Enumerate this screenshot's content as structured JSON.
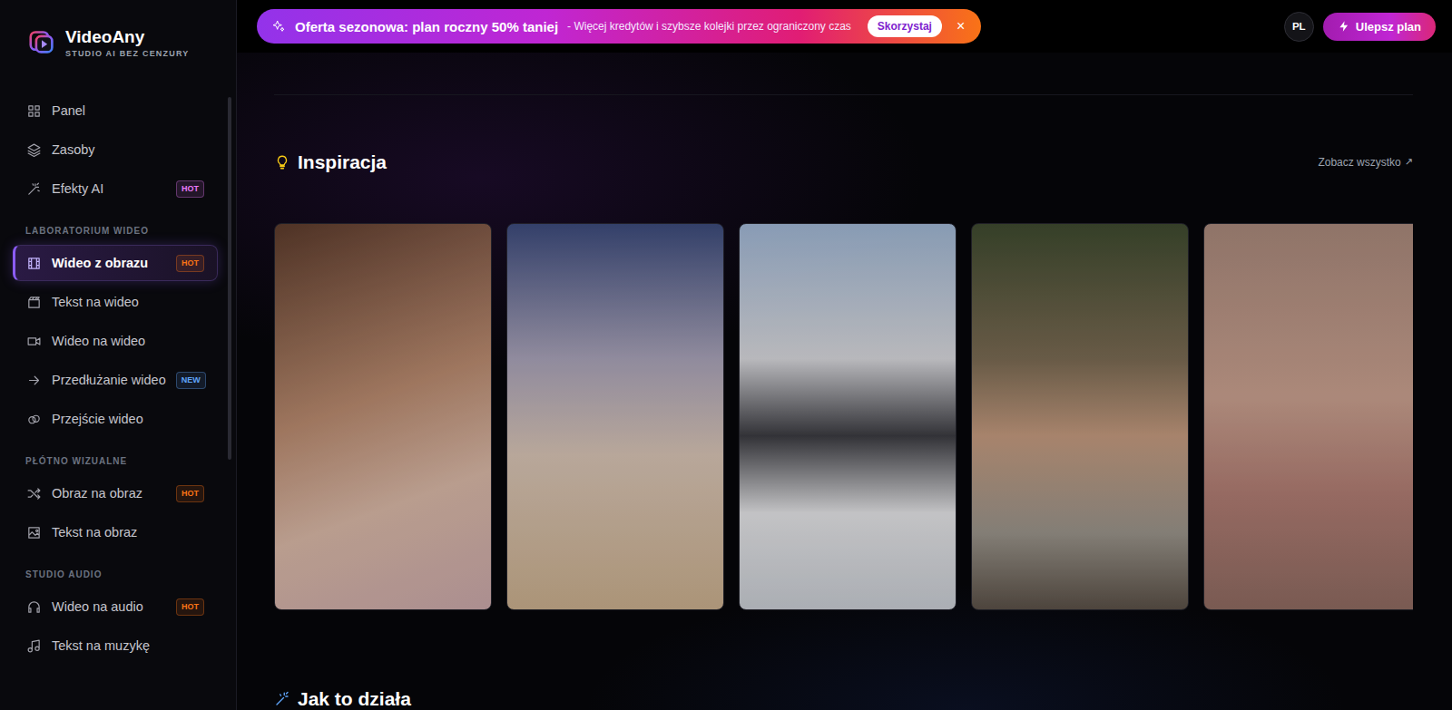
{
  "logo": {
    "name": "VideoAny",
    "tagline": "STUDIO AI BEZ CENZURY"
  },
  "sidebar": {
    "groups": [
      {
        "items": [
          {
            "label": "Panel",
            "selected": false
          },
          {
            "label": "Zasoby",
            "selected": false
          },
          {
            "label": "Efekty AI",
            "selected": false,
            "badge": {
              "text": "HOT",
              "color": "#e879f9"
            }
          }
        ]
      },
      {
        "title": "LABORATORIUM WIDEO",
        "items": [
          {
            "label": "Wideo z obrazu",
            "selected": true,
            "badge": {
              "text": "HOT",
              "color": "#f97316"
            }
          },
          {
            "label": "Tekst na wideo",
            "selected": false
          },
          {
            "label": "Wideo na wideo",
            "selected": false
          },
          {
            "label": "Przedłużanie wideo",
            "selected": false,
            "badge": {
              "text": "NEW",
              "color": "#60a5fa"
            }
          },
          {
            "label": "Przejście wideo",
            "selected": false
          }
        ]
      },
      {
        "title": "PŁÓTNO WIZUALNE",
        "items": [
          {
            "label": "Obraz na obraz",
            "selected": false,
            "badge": {
              "text": "HOT",
              "color": "#f97316"
            }
          },
          {
            "label": "Tekst na obraz",
            "selected": false
          }
        ]
      },
      {
        "title": "STUDIO AUDIO",
        "items": [
          {
            "label": "Wideo na audio",
            "selected": false,
            "badge": {
              "text": "HOT",
              "color": "#f97316"
            }
          },
          {
            "label": "Tekst na muzykę",
            "selected": false
          }
        ]
      }
    ]
  },
  "banner": {
    "title": "Oferta sezonowa: plan roczny 50% taniej",
    "text": "- Więcej kredytów i szybsze kolejki przez ograniczony czas",
    "action": "Skorzystaj",
    "close": "×"
  },
  "header": {
    "language": "PL",
    "upgrade": "Ulepsz plan"
  },
  "inspiration": {
    "title": "Inspiracja",
    "see_all": "Zobacz wszystko",
    "see_all_icon": "↗",
    "cards": [
      {
        "kind": "photo"
      },
      {
        "kind": "photo"
      },
      {
        "kind": "photo"
      },
      {
        "kind": "photo"
      },
      {
        "kind": "photo"
      }
    ]
  },
  "how": {
    "title": "Jak to działa"
  }
}
